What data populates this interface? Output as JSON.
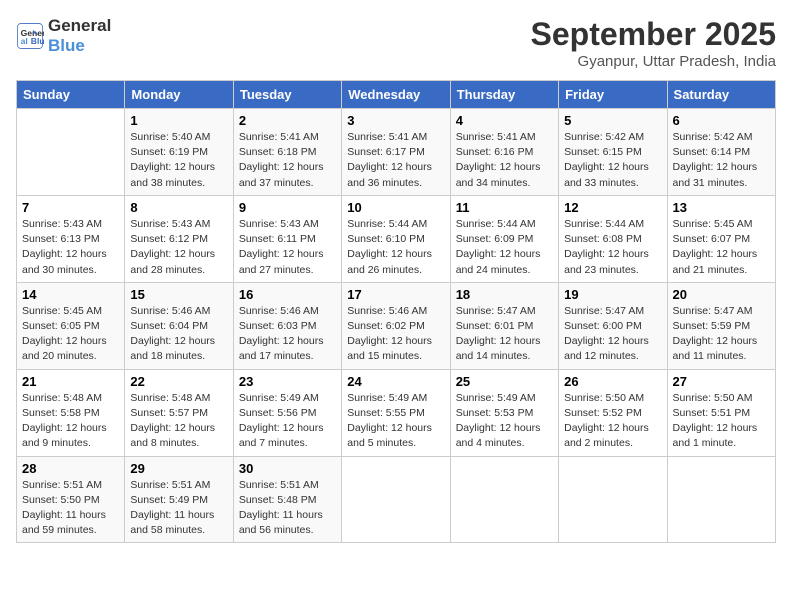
{
  "logo": {
    "line1": "General",
    "line2": "Blue"
  },
  "title": "September 2025",
  "location": "Gyanpur, Uttar Pradesh, India",
  "weekdays": [
    "Sunday",
    "Monday",
    "Tuesday",
    "Wednesday",
    "Thursday",
    "Friday",
    "Saturday"
  ],
  "weeks": [
    [
      {
        "day": null,
        "info": null
      },
      {
        "day": "1",
        "info": "Sunrise: 5:40 AM\nSunset: 6:19 PM\nDaylight: 12 hours\nand 38 minutes."
      },
      {
        "day": "2",
        "info": "Sunrise: 5:41 AM\nSunset: 6:18 PM\nDaylight: 12 hours\nand 37 minutes."
      },
      {
        "day": "3",
        "info": "Sunrise: 5:41 AM\nSunset: 6:17 PM\nDaylight: 12 hours\nand 36 minutes."
      },
      {
        "day": "4",
        "info": "Sunrise: 5:41 AM\nSunset: 6:16 PM\nDaylight: 12 hours\nand 34 minutes."
      },
      {
        "day": "5",
        "info": "Sunrise: 5:42 AM\nSunset: 6:15 PM\nDaylight: 12 hours\nand 33 minutes."
      },
      {
        "day": "6",
        "info": "Sunrise: 5:42 AM\nSunset: 6:14 PM\nDaylight: 12 hours\nand 31 minutes."
      }
    ],
    [
      {
        "day": "7",
        "info": "Sunrise: 5:43 AM\nSunset: 6:13 PM\nDaylight: 12 hours\nand 30 minutes."
      },
      {
        "day": "8",
        "info": "Sunrise: 5:43 AM\nSunset: 6:12 PM\nDaylight: 12 hours\nand 28 minutes."
      },
      {
        "day": "9",
        "info": "Sunrise: 5:43 AM\nSunset: 6:11 PM\nDaylight: 12 hours\nand 27 minutes."
      },
      {
        "day": "10",
        "info": "Sunrise: 5:44 AM\nSunset: 6:10 PM\nDaylight: 12 hours\nand 26 minutes."
      },
      {
        "day": "11",
        "info": "Sunrise: 5:44 AM\nSunset: 6:09 PM\nDaylight: 12 hours\nand 24 minutes."
      },
      {
        "day": "12",
        "info": "Sunrise: 5:44 AM\nSunset: 6:08 PM\nDaylight: 12 hours\nand 23 minutes."
      },
      {
        "day": "13",
        "info": "Sunrise: 5:45 AM\nSunset: 6:07 PM\nDaylight: 12 hours\nand 21 minutes."
      }
    ],
    [
      {
        "day": "14",
        "info": "Sunrise: 5:45 AM\nSunset: 6:05 PM\nDaylight: 12 hours\nand 20 minutes."
      },
      {
        "day": "15",
        "info": "Sunrise: 5:46 AM\nSunset: 6:04 PM\nDaylight: 12 hours\nand 18 minutes."
      },
      {
        "day": "16",
        "info": "Sunrise: 5:46 AM\nSunset: 6:03 PM\nDaylight: 12 hours\nand 17 minutes."
      },
      {
        "day": "17",
        "info": "Sunrise: 5:46 AM\nSunset: 6:02 PM\nDaylight: 12 hours\nand 15 minutes."
      },
      {
        "day": "18",
        "info": "Sunrise: 5:47 AM\nSunset: 6:01 PM\nDaylight: 12 hours\nand 14 minutes."
      },
      {
        "day": "19",
        "info": "Sunrise: 5:47 AM\nSunset: 6:00 PM\nDaylight: 12 hours\nand 12 minutes."
      },
      {
        "day": "20",
        "info": "Sunrise: 5:47 AM\nSunset: 5:59 PM\nDaylight: 12 hours\nand 11 minutes."
      }
    ],
    [
      {
        "day": "21",
        "info": "Sunrise: 5:48 AM\nSunset: 5:58 PM\nDaylight: 12 hours\nand 9 minutes."
      },
      {
        "day": "22",
        "info": "Sunrise: 5:48 AM\nSunset: 5:57 PM\nDaylight: 12 hours\nand 8 minutes."
      },
      {
        "day": "23",
        "info": "Sunrise: 5:49 AM\nSunset: 5:56 PM\nDaylight: 12 hours\nand 7 minutes."
      },
      {
        "day": "24",
        "info": "Sunrise: 5:49 AM\nSunset: 5:55 PM\nDaylight: 12 hours\nand 5 minutes."
      },
      {
        "day": "25",
        "info": "Sunrise: 5:49 AM\nSunset: 5:53 PM\nDaylight: 12 hours\nand 4 minutes."
      },
      {
        "day": "26",
        "info": "Sunrise: 5:50 AM\nSunset: 5:52 PM\nDaylight: 12 hours\nand 2 minutes."
      },
      {
        "day": "27",
        "info": "Sunrise: 5:50 AM\nSunset: 5:51 PM\nDaylight: 12 hours\nand 1 minute."
      }
    ],
    [
      {
        "day": "28",
        "info": "Sunrise: 5:51 AM\nSunset: 5:50 PM\nDaylight: 11 hours\nand 59 minutes."
      },
      {
        "day": "29",
        "info": "Sunrise: 5:51 AM\nSunset: 5:49 PM\nDaylight: 11 hours\nand 58 minutes."
      },
      {
        "day": "30",
        "info": "Sunrise: 5:51 AM\nSunset: 5:48 PM\nDaylight: 11 hours\nand 56 minutes."
      },
      {
        "day": null,
        "info": null
      },
      {
        "day": null,
        "info": null
      },
      {
        "day": null,
        "info": null
      },
      {
        "day": null,
        "info": null
      }
    ]
  ]
}
